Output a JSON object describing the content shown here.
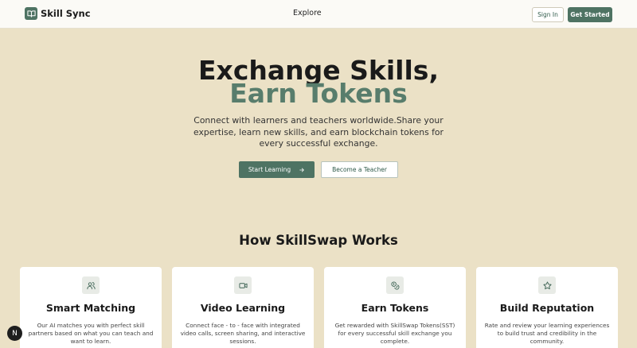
{
  "header": {
    "brand": "Skill Sync",
    "nav_explore": "Explore",
    "signin_label": "Sign In",
    "get_started_label": "Get Started"
  },
  "hero": {
    "title_line1": "Exchange Skills,",
    "title_line2": "Earn Tokens",
    "description": "Connect with learners and teachers worldwide.Share your expertise, learn new skills, and earn blockchain tokens for every successful exchange.",
    "start_learning_label": "Start Learning",
    "become_teacher_label": "Become a Teacher"
  },
  "how": {
    "title": "How SkillSwap Works",
    "cards": [
      {
        "icon": "users-icon",
        "title": "Smart Matching",
        "desc": "Our AI matches you with perfect skill partners based on what you can teach and want to learn."
      },
      {
        "icon": "video-icon",
        "title": "Video Learning",
        "desc": "Connect face - to - face with integrated video calls, screen sharing, and interactive sessions."
      },
      {
        "icon": "coins-icon",
        "title": "Earn Tokens",
        "desc": "Get rewarded with SkillSwap Tokens(SST) for every successful skill exchange you complete."
      },
      {
        "icon": "star-icon",
        "title": "Build Reputation",
        "desc": "Rate and review your learning experiences to build trust and credibility in the community."
      }
    ]
  },
  "badge": {
    "letter": "N"
  },
  "colors": {
    "accent": "#4e7363",
    "background": "#ebe1c6",
    "title_accent": "#587d6c"
  }
}
